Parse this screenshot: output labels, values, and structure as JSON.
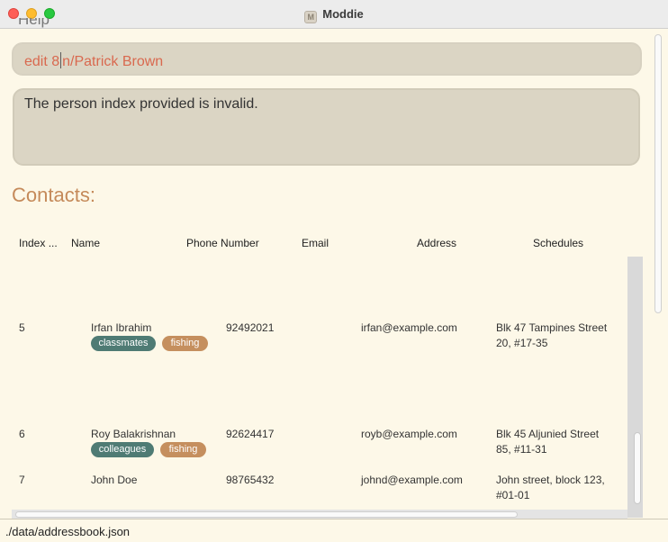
{
  "window": {
    "title": "Moddie"
  },
  "menu": {
    "help_label": "Help"
  },
  "command": {
    "before_caret": "edit 8",
    "after_caret": "n/Patrick Brown"
  },
  "result": {
    "message": "The person index provided is invalid."
  },
  "contacts": {
    "title": "Contacts:",
    "columns": [
      "Index ...",
      "Name",
      "Phone Number",
      "Email",
      "Address",
      "Schedules"
    ],
    "rows": [
      {
        "index": "5",
        "name": "Irfan Ibrahim",
        "phone": "92492021",
        "email": "irfan@example.com",
        "address_line1": "Blk 47 Tampines Street",
        "address_line2": "20, #17-35",
        "tags": [
          {
            "label": "classmates",
            "color": "#4f7b74"
          },
          {
            "label": "fishing",
            "color": "#c58f5e"
          }
        ]
      },
      {
        "index": "6",
        "name": "Roy Balakrishnan",
        "phone": "92624417",
        "email": "royb@example.com",
        "address_line1": "Blk 45 Aljunied Street",
        "address_line2": "85, #11-31",
        "tags": [
          {
            "label": "colleagues",
            "color": "#4f7b74"
          },
          {
            "label": "fishing",
            "color": "#c58f5e"
          }
        ]
      },
      {
        "index": "7",
        "name": "John Doe",
        "phone": "98765432",
        "email": "johnd@example.com",
        "address_line1": "John street, block 123,",
        "address_line2": "#01-01",
        "tags": []
      }
    ]
  },
  "status": {
    "file_path": "./data/addressbook.json"
  },
  "colors": {
    "accent_heading": "#c58a5a",
    "command_text": "#d9694f",
    "tag_teal": "#4f7b74",
    "tag_tan": "#c58f5e"
  }
}
